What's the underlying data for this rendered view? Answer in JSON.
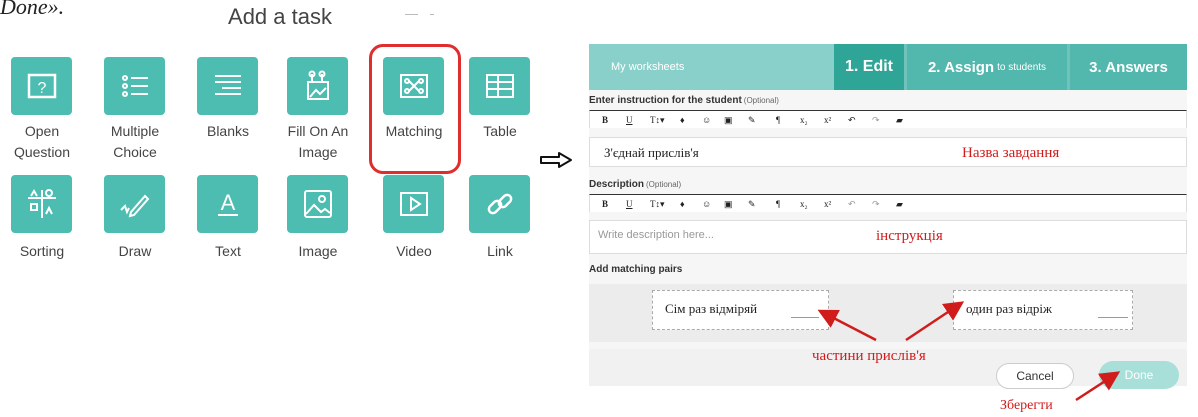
{
  "fragment": "Done».",
  "left": {
    "title": "Add a task",
    "tiles": [
      {
        "label": "Open\nQuestion",
        "icon": "question-box-icon"
      },
      {
        "label": "Multiple\nChoice",
        "icon": "list-icon"
      },
      {
        "label": "Blanks",
        "icon": "blanks-icon"
      },
      {
        "label": "Fill On An\nImage",
        "icon": "fill-image-icon"
      },
      {
        "label": "Matching",
        "icon": "matching-icon"
      },
      {
        "label": "Table",
        "icon": "table-icon"
      },
      {
        "label": "Sorting",
        "icon": "sorting-icon"
      },
      {
        "label": "Draw",
        "icon": "pencil-icon"
      },
      {
        "label": "Text",
        "icon": "text-icon"
      },
      {
        "label": "Image",
        "icon": "image-icon"
      },
      {
        "label": "Video",
        "icon": "play-icon"
      },
      {
        "label": "Link",
        "icon": "link-icon"
      }
    ]
  },
  "editor": {
    "tabs": {
      "worksheets": "My worksheets",
      "edit": "1. Edit",
      "assign": "2. Assign",
      "assign_small": "to students",
      "answers": "3. Answers"
    },
    "instruction_label": "Enter instruction for the student",
    "description_label": "Description",
    "optional": "(Optional)",
    "toolbar": [
      "B",
      "U",
      "T↕▾",
      "♦",
      "☺",
      "▣",
      "✎",
      "¶",
      "x₂",
      "x²",
      "↶",
      "↷",
      "▰"
    ],
    "instruction_value": "З'єднай прислів'я",
    "description_placeholder": "Write description here...",
    "pairs_label": "Add matching pairs",
    "pair_left": "Сім раз відміряй",
    "pair_right": "один раз  відріж",
    "cancel": "Cancel",
    "done": "Done"
  },
  "annotations": {
    "task_name": "Назва завдання",
    "instruction": "інструкція",
    "proverb_parts": "частини прислів'я",
    "save": "Зберегти"
  },
  "colors": {
    "accent": "#4cbdb0",
    "header_active": "#2fa597",
    "annotation": "#d11c1c"
  }
}
